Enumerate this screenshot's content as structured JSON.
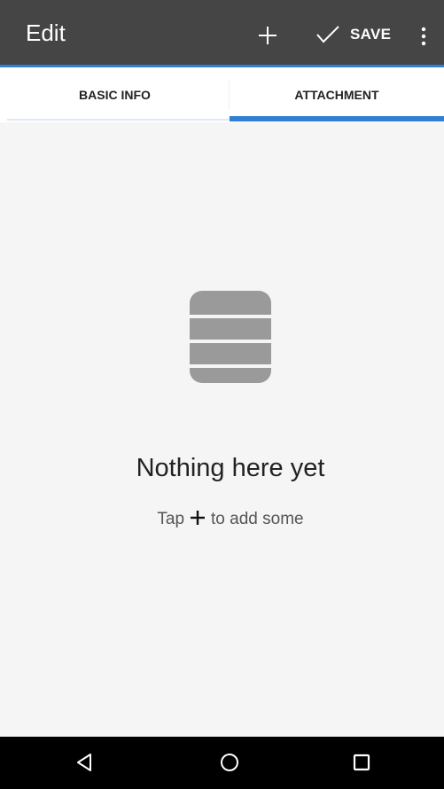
{
  "appbar": {
    "title": "Edit",
    "save_label": "SAVE",
    "background": "#454545",
    "accent": "#2f7fd4"
  },
  "tabs": [
    {
      "label": "BASIC INFO",
      "selected": false
    },
    {
      "label": "ATTACHMENT",
      "selected": true
    }
  ],
  "empty_state": {
    "icon": "database-icon",
    "title": "Nothing here yet",
    "hint_before": "Tap",
    "hint_icon": "plus-icon",
    "hint_after": "to add some"
  },
  "navbar": {
    "buttons": [
      "back-icon",
      "home-icon",
      "recents-icon"
    ]
  }
}
